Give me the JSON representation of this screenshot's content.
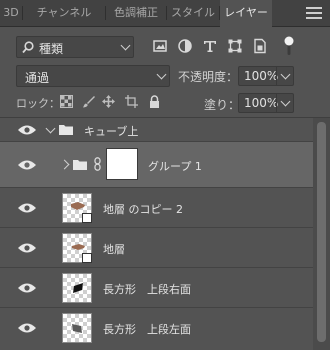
{
  "tabs": [
    {
      "label": "3D"
    },
    {
      "label": "チャンネル"
    },
    {
      "label": "色調補正"
    },
    {
      "label": "スタイル"
    },
    {
      "label": "レイヤー"
    }
  ],
  "active_tab": "レイヤー",
  "filter": {
    "kind_label": "種類"
  },
  "filter_icons": [
    "pixel-filter-icon",
    "adjustment-filter-icon",
    "type-filter-icon",
    "shape-filter-icon",
    "smart-object-filter-icon",
    "filter-toggle-icon"
  ],
  "blend": {
    "mode": "通過"
  },
  "opacity": {
    "label": "不透明度：",
    "value": "100%"
  },
  "lock": {
    "label": "ロック："
  },
  "lock_icons": [
    "lock-transparent-icon",
    "lock-image-icon",
    "lock-position-icon",
    "lock-artboard-icon",
    "lock-all-icon"
  ],
  "fill": {
    "label": "塗り：",
    "value": "100%"
  },
  "layers": [
    {
      "name": "キューブ上",
      "type": "group",
      "expanded": true,
      "visible": true
    },
    {
      "name": "グループ 1",
      "type": "group",
      "expanded": false,
      "visible": true,
      "selected": true
    },
    {
      "name": "地層 のコピー 2",
      "type": "smart-object",
      "visible": true
    },
    {
      "name": "地層",
      "type": "smart-object",
      "visible": true
    },
    {
      "name": "長方形　上段右面",
      "type": "smart-object",
      "visible": true
    },
    {
      "name": "長方形　上段左面",
      "type": "smart-object",
      "visible": true
    }
  ],
  "colors": {
    "panel_bg": "#535353",
    "tabbar_bg": "#424242",
    "selected_row": "#666666"
  }
}
